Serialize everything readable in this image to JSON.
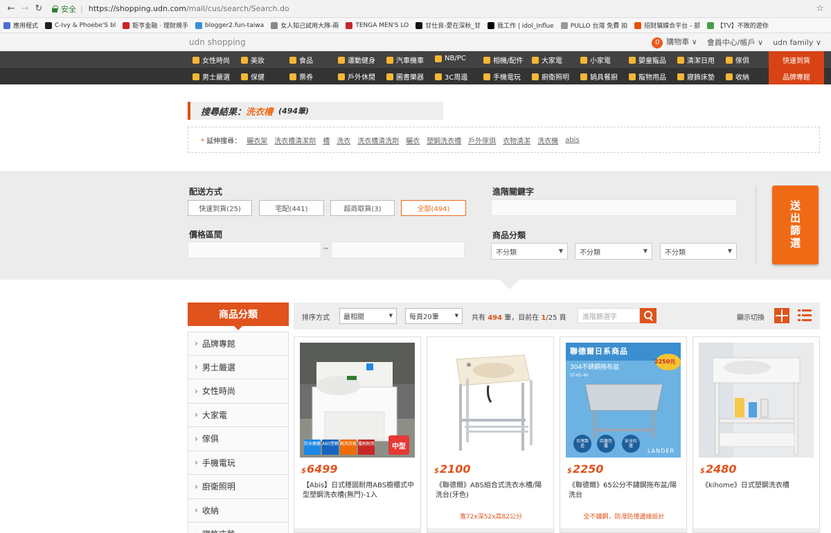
{
  "browser": {
    "secure_label": "安全",
    "url_host": "https://shopping.udn.com",
    "url_path": "/mall/cus/search/Search.do",
    "bookmarks": [
      {
        "label": "應用程式",
        "color": "#4a6fd8"
      },
      {
        "label": "C-Ivy & Phoebe'S bl",
        "color": "#222222"
      },
      {
        "label": "鉅亨金融 · 理財規手",
        "color": "#cc2222"
      },
      {
        "label": "blogger2.fun-taiwa",
        "color": "#3b8fd9"
      },
      {
        "label": "女人知己試用大隊-兩",
        "color": "#888888"
      },
      {
        "label": "TENGA MEN'S LO",
        "color": "#c62828"
      },
      {
        "label": "甘仕良-愛在深秋_甘",
        "color": "#111111"
      },
      {
        "label": "我工作 | idol_Influe",
        "color": "#000000"
      },
      {
        "label": "PULLO 台灣 免費 拍",
        "color": "#999999"
      },
      {
        "label": "招財貓媒合平台 - 部",
        "color": "#e65100"
      },
      {
        "label": "【TV】不敗的遊你",
        "color": "#43a047"
      }
    ]
  },
  "topbar": {
    "brand": "udn shopping",
    "cart_count": "0",
    "cart_label": "購物車 ∨",
    "member_label": "會員中心/帳戶 ∨",
    "family_label": "udn family ∨"
  },
  "nav": {
    "row1": [
      "女性時尚",
      "美妝",
      "食品",
      "運動健身",
      "汽車機車",
      "NB/PC",
      "相機/配件",
      "大家電",
      "小家電",
      "嬰童寵品",
      "清潔日用",
      "傢俱"
    ],
    "row2": [
      "男士嚴選",
      "保健",
      "票券",
      "戶外休閒",
      "圖書樂器",
      "3C周邊",
      "手機電玩",
      "廚衛照明",
      "鍋具餐廚",
      "寵物用品",
      "寢飾床墊",
      "收納"
    ],
    "special1": "快速到貨",
    "special2": "品牌專館"
  },
  "result": {
    "prefix": "搜尋結果：",
    "keyword": "洗衣槽",
    "count": "(494筆)"
  },
  "extended": {
    "label": "延伸搜尋：",
    "links": [
      "曬衣架",
      "洗衣槽清潔劑",
      "槽",
      "洗衣",
      "洗衣槽清洗劑",
      "曬衣",
      "塑鋼洗衣槽",
      "戶外傢俱",
      "衣物清潔",
      "洗衣機",
      "abis"
    ]
  },
  "filter": {
    "delivery_label": "配送方式",
    "delivery_options": [
      "快速到貨(25)",
      "宅配(441)",
      "超商取貨(3)",
      "全部(494)"
    ],
    "price_label": "價格區間",
    "price_sep": "~",
    "keyword_label": "進階關鍵字",
    "category_label": "商品分類",
    "category_selects": [
      "不分類",
      "不分類",
      "不分類"
    ],
    "submit_label": "送出篩選"
  },
  "sidebar": {
    "title": "商品分類",
    "items": [
      "品牌專館",
      "男士嚴選",
      "女性時尚",
      "大家電",
      "傢俱",
      "手機電玩",
      "廚衛照明",
      "收納",
      "寢飾床墊"
    ]
  },
  "toolbar": {
    "sort_label": "排序方式",
    "sort_value": "最相關",
    "per_page_value": "每頁20筆",
    "count_pre": "共有",
    "count_num": "494",
    "count_mid": "筆，目前在",
    "page_cur": "1",
    "page_rest": "/25 頁",
    "search_placeholder": "進階篩選字",
    "view_label": "顯示切換"
  },
  "products": [
    {
      "currency": "$",
      "price": "6499",
      "name": "【Abis】日式穩固耐用ABS櫥櫃式中型塑鋼洗衣槽(無門)-1入",
      "note": ""
    },
    {
      "currency": "$",
      "price": "2100",
      "name": "《聯德爾》ABS組合式洗衣水槽/陽洗台(牙色)",
      "note": "寬72x深52x高82公分"
    },
    {
      "currency": "$",
      "price": "2250",
      "name": "《聯德爾》65公分不鏽鋼拖布盆/陽洗台",
      "note": "全不鏽鋼，防潑防撞邊緣設計"
    },
    {
      "currency": "$",
      "price": "2480",
      "name": "《kihome》日式塑鋼洗衣槽",
      "note": ""
    }
  ],
  "product_image_text": {
    "p1_badge": "中型",
    "p1_tags": [
      "防水櫥櫃",
      "ABS塑鋼",
      "耐洗衣板",
      "覆耐耐用"
    ],
    "p3_banner": "聯德爾日系商品",
    "p3_sub": "304不銹鋼拖布盆",
    "p3_price_tag": "2250元",
    "p3_model": "ST-65-40",
    "p3_circles": [
      "台灣製造",
      "四邊包覆",
      "安全防撞"
    ],
    "p3_brand": "LANDER"
  },
  "colors": {
    "accent": "#e0531d",
    "nav_dark": "#3a3a3a",
    "filter_bg": "#ececec"
  }
}
